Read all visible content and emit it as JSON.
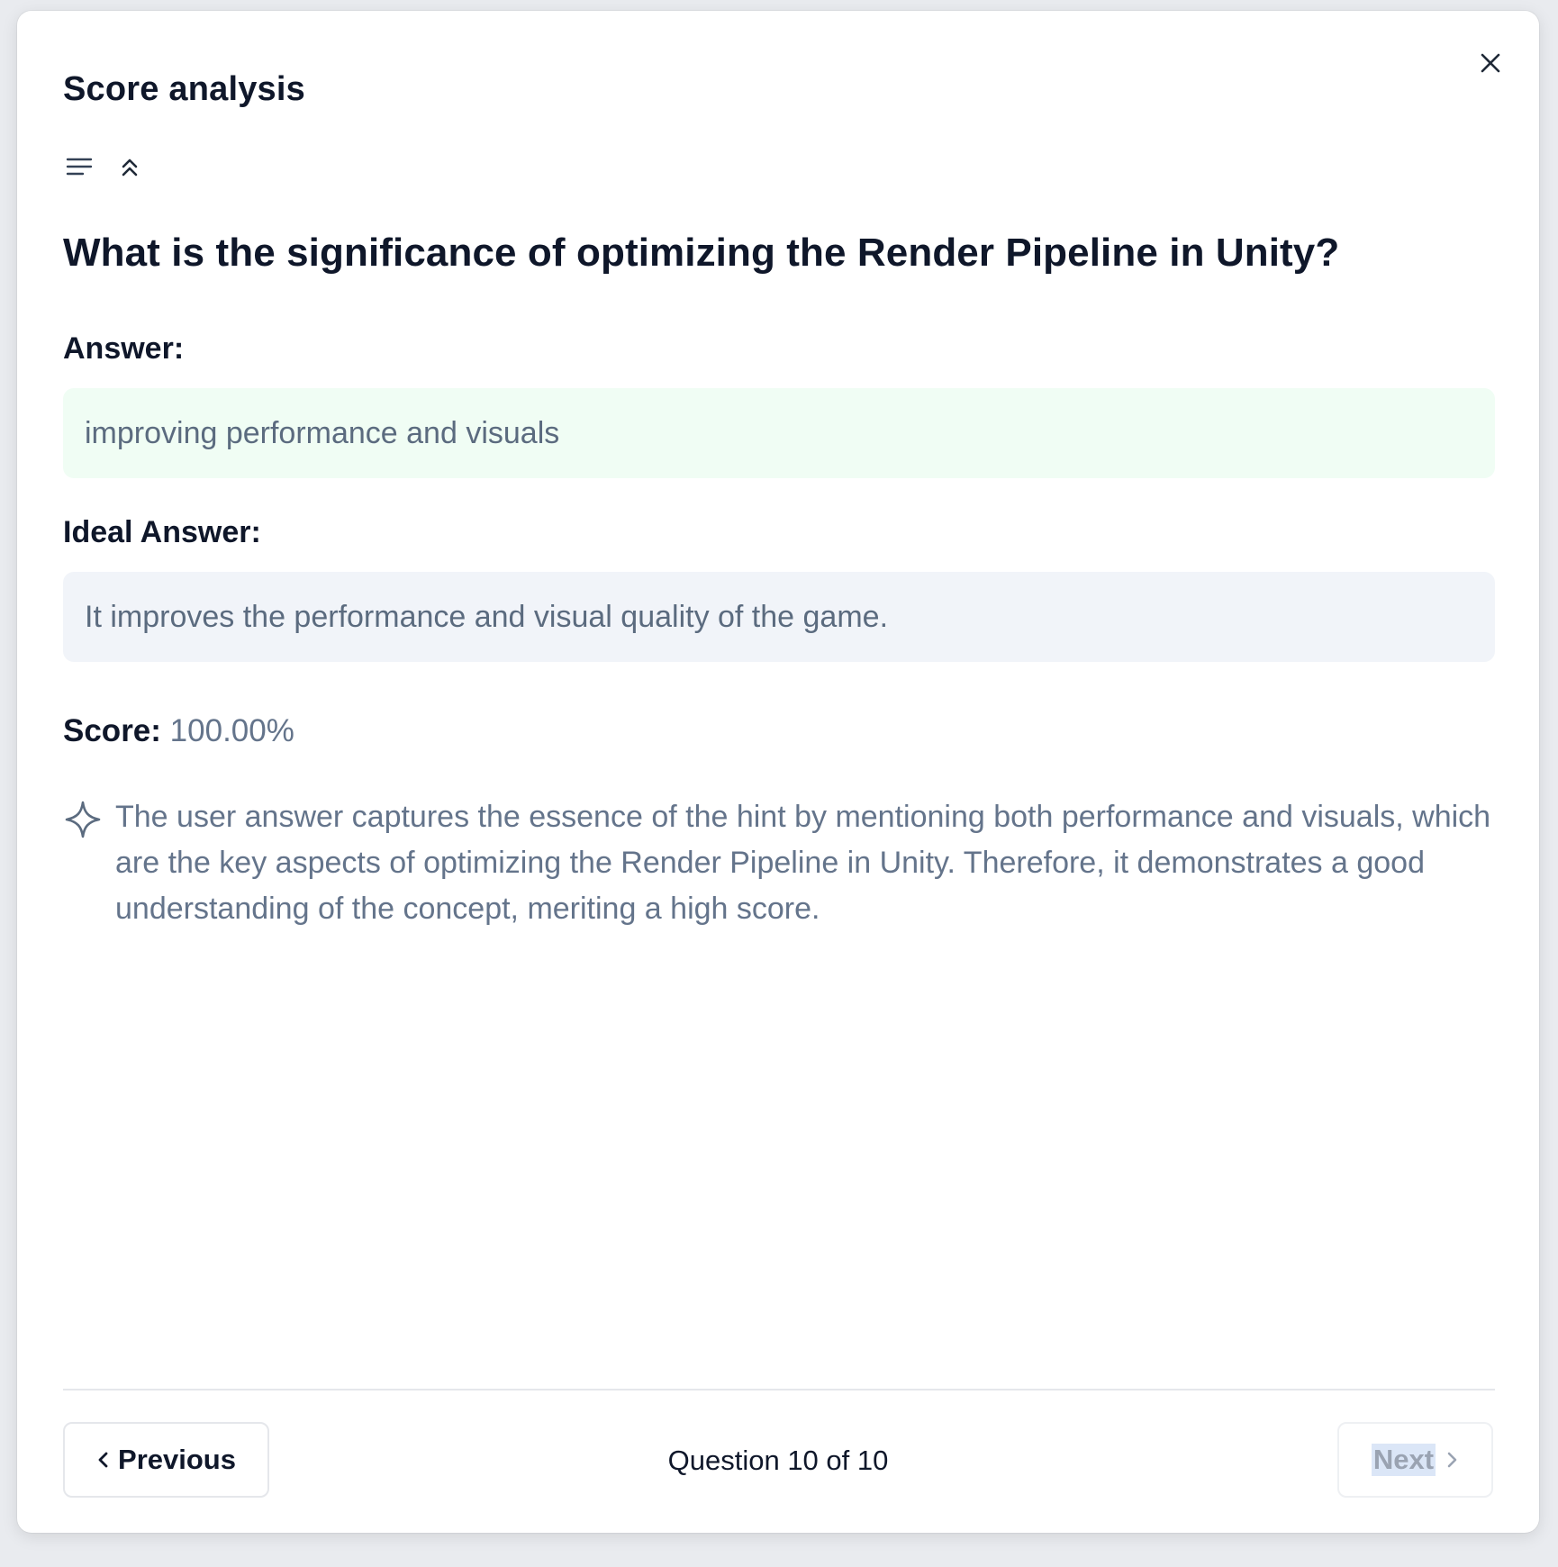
{
  "dialog": {
    "title": "Score analysis",
    "close_icon": "close-icon"
  },
  "toolbar": {
    "icons": [
      "align-left-icon",
      "chevrons-up-icon"
    ]
  },
  "question": "What is the significance of optimizing the Render Pipeline in Unity?",
  "answer": {
    "label": "Answer:",
    "value": "improving performance and visuals"
  },
  "ideal_answer": {
    "label": "Ideal Answer:",
    "value": "It improves the performance and visual quality of the game."
  },
  "score": {
    "label": "Score:",
    "value": "100.00%"
  },
  "explanation": {
    "icon": "sparkle-icon",
    "text": "The user answer captures the essence of the hint by mentioning both performance and visuals, which are the key aspects of optimizing the Render Pipeline in Unity. Therefore, it demonstrates a good understanding of the concept, meriting a high score."
  },
  "footer": {
    "previous_label": "Previous",
    "pager": "Question 10 of 10",
    "next_label": "Next",
    "next_disabled": true
  },
  "colors": {
    "answer_bg": "#f0fdf4",
    "ideal_bg": "#f1f4f9",
    "muted_text": "#64748b",
    "heading_text": "#0f172a"
  }
}
